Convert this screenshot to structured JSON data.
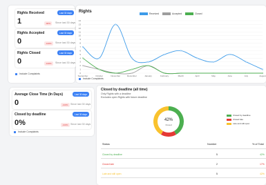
{
  "stats": {
    "received": {
      "title": "Rights Received",
      "badge": "Last 30 days",
      "value": "1",
      "pct": "-90%",
      "since": "Since last 30 days"
    },
    "accepted": {
      "title": "Rights Accepted",
      "badge": "Last 30 days",
      "value": "0",
      "pct": "-100%",
      "since": "Since last 30 days"
    },
    "closed": {
      "title": "Rights Closed",
      "badge": "Last 30 days",
      "value": "0",
      "pct": "-100%",
      "since": "Since last 30 days"
    }
  },
  "include_label": "Include Complaints",
  "stats2": {
    "avg": {
      "title": "Average Close Time (In Days)",
      "badge": "Last 30 days",
      "value": "0",
      "pct": "-100%",
      "since": "Since last 30 days"
    },
    "deadline": {
      "title": "Closed by deadline",
      "badge": "Last 30 days",
      "value": "0%",
      "pct": "-100%",
      "since": "Since last 30 days"
    }
  },
  "colors": {
    "blue": "#3d9be9",
    "gray": "#9e9e9e",
    "green": "#4caf50",
    "red": "#e53935",
    "yellow": "#f9c22e",
    "badge": "#3d82f5"
  },
  "chart_data": {
    "type": "line",
    "title": "Rights",
    "categories": [
      "September",
      "October",
      "November",
      "December",
      "January",
      "February",
      "March",
      "April",
      "May",
      "June",
      "July",
      "August"
    ],
    "ylim": [
      0,
      14
    ],
    "yticks": [
      0,
      1,
      2,
      3,
      4,
      5,
      6,
      7,
      8,
      9,
      10,
      11,
      12,
      13,
      14
    ],
    "grid": true,
    "legend_position": "top",
    "series": [
      {
        "name": "Received",
        "color": "#3d9be9",
        "values": [
          7,
          4,
          13,
          4,
          3,
          5,
          6,
          4,
          3,
          5,
          3,
          1
        ]
      },
      {
        "name": "Accepted",
        "color": "#9e9e9e",
        "values": [
          2,
          1,
          0,
          0,
          2,
          0,
          0,
          0,
          0,
          0,
          0,
          0
        ]
      },
      {
        "name": "Closed",
        "color": "#4caf50",
        "values": [
          4,
          1,
          0,
          1,
          2,
          0,
          0,
          0,
          0,
          0,
          0,
          0
        ]
      }
    ]
  },
  "deadline_card": {
    "title": "Closed by deadline (all time)",
    "sub1": "Only Rights with a deadline",
    "sub2": "Excludes open Rights with future deadline",
    "donut_pct": "42%",
    "donut_label": "Closed",
    "donut": [
      {
        "label": "Closed by deadline",
        "value": 5,
        "color": "#4caf50"
      },
      {
        "label": "Closed late",
        "value": 2,
        "color": "#e53935"
      },
      {
        "label": "Late and still open",
        "value": 5,
        "color": "#f9c22e"
      }
    ],
    "table": {
      "headers": [
        "Status",
        "Number",
        "% of Total"
      ],
      "rows": [
        {
          "status": "Closed by deadline",
          "number": "5",
          "pct": "42%",
          "color": "#4caf50"
        },
        {
          "status": "Closed late",
          "number": "2",
          "pct": "17%",
          "color": "#e53935"
        },
        {
          "status": "Late and still open",
          "number": "5",
          "pct": "42%",
          "color": "#f9c22e"
        }
      ]
    }
  }
}
